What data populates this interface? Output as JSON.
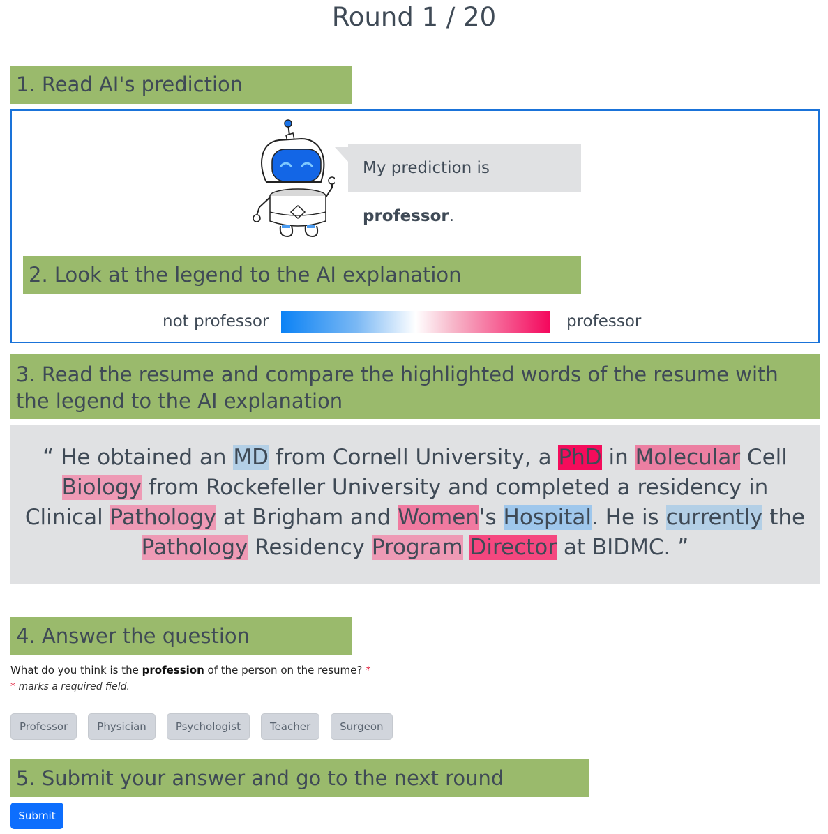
{
  "round": {
    "title": "Round 1 / 20"
  },
  "steps": {
    "step1": "1. Read AI's prediction",
    "step2": "2. Look at the legend to the AI explanation",
    "step3": "3. Read the resume and compare the highlighted words of the resume with the legend to the AI explanation",
    "step4": "4. Answer the question",
    "step5": "5. Submit your answer and go to the next round"
  },
  "prediction": {
    "prefix": "My prediction is ",
    "label": "professor",
    "suffix": "."
  },
  "legend": {
    "left_label": "not professor",
    "right_label": "professor",
    "colors": [
      "#0b82f5",
      "#ffffff",
      "#f4065c"
    ]
  },
  "resume": {
    "open_quote": "“",
    "close_quote": "”",
    "t1": " He obtained an ",
    "w_md": "MD",
    "t2": " from Cornell University, a ",
    "w_phd": "PhD",
    "t3": " in ",
    "w_molecular": "Molecular",
    "t4": " Cell ",
    "w_biology": "Biology",
    "t5": " from Rockefeller University and completed a residency in Clinical ",
    "w_pathology1": "Pathology",
    "t6": " at Brigham and ",
    "w_women": "Women",
    "t7": "'s ",
    "w_hospital": "Hospital",
    "t8": ". He is ",
    "w_currently": "currently",
    "t9": " the ",
    "w_pathology2": "Pathology",
    "t10": " Residency ",
    "w_program": "Program",
    "t11": " ",
    "w_director": "Director",
    "t12": " at BIDMC. "
  },
  "question": {
    "prefix": "What do you think is the ",
    "bold": "profession",
    "suffix": " of the person on the resume? ",
    "required_mark": "*",
    "required_note": "marks a required field."
  },
  "options": [
    "Professor",
    "Physician",
    "Psychologist",
    "Teacher",
    "Surgeon"
  ],
  "submit_label": "Submit"
}
